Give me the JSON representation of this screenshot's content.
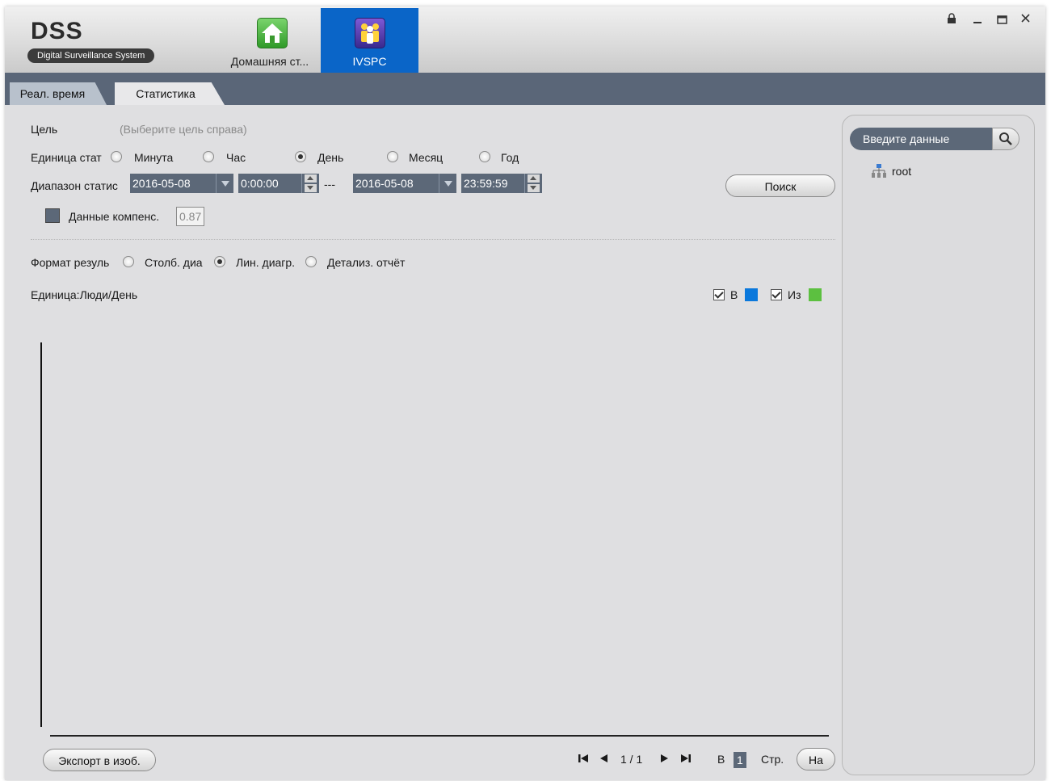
{
  "app": {
    "logo_title": "DSS",
    "logo_subtitle": "Digital Surveillance System"
  },
  "app_tabs": [
    {
      "label": "Домашняя ст...",
      "icon": "home-icon"
    },
    {
      "label": "IVSPC",
      "icon": "people-counting-icon"
    }
  ],
  "window_controls": {
    "lock": "🔒",
    "minimize": "–",
    "maximize": "□",
    "close": "✕"
  },
  "sub_tabs": [
    {
      "label": "Реал. время",
      "active": false
    },
    {
      "label": "Статистика",
      "active": true
    }
  ],
  "form": {
    "target_label": "Цель",
    "target_hint": "(Выберите цель справа)",
    "unit_label": "Единица стат",
    "units": [
      {
        "label": "Минута",
        "selected": false
      },
      {
        "label": "Час",
        "selected": false
      },
      {
        "label": "День",
        "selected": true
      },
      {
        "label": "Месяц",
        "selected": false
      },
      {
        "label": "Год",
        "selected": false
      }
    ],
    "range_label": "Диапазон статис",
    "start_date": "2016-05-08",
    "start_time": "0:00:00",
    "range_separator": "---",
    "end_date": "2016-05-08",
    "end_time": "23:59:59",
    "search_button": "Поиск",
    "comp_label": "Данные компенс.",
    "comp_value": "0.87",
    "format_label": "Формат резуль",
    "formats": [
      {
        "label": "Столб. диа",
        "selected": false
      },
      {
        "label": "Лин. диагр.",
        "selected": true
      },
      {
        "label": "Детализ. отчёт",
        "selected": false
      }
    ]
  },
  "chart": {
    "unit_text": "Единица:Люди/День",
    "legend": [
      {
        "label": "В",
        "checked": true,
        "color": "#0a78dc"
      },
      {
        "label": "Из",
        "checked": true,
        "color": "#5cc040"
      }
    ]
  },
  "chart_data": {
    "type": "line",
    "series": [],
    "xlabel": "",
    "ylabel": ""
  },
  "footer": {
    "export_button": "Экспорт в изоб.",
    "page_indicator": "1 / 1",
    "goto_prefix": "В",
    "goto_value": "1",
    "goto_suffix": "Стр.",
    "goto_button": "На"
  },
  "right_panel": {
    "search_placeholder": "Введите данные",
    "tree_root": "root"
  }
}
